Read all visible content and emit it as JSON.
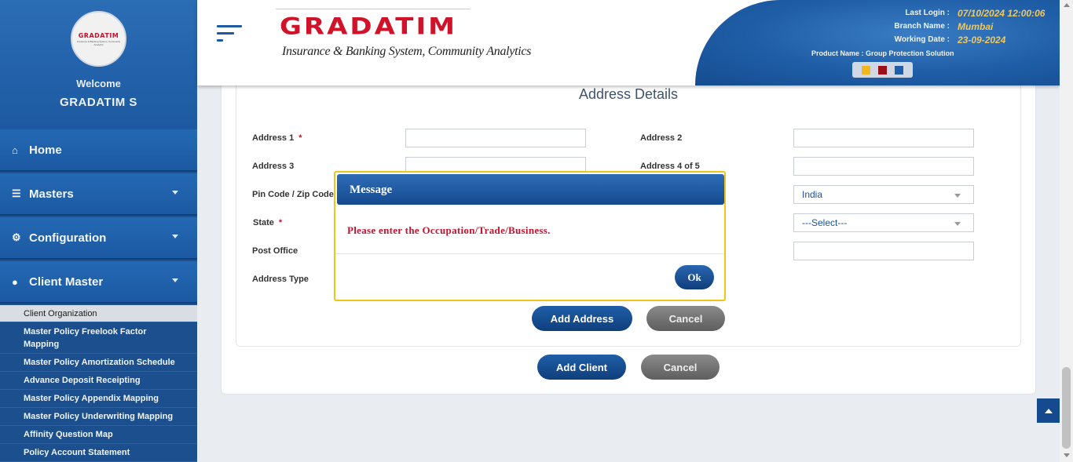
{
  "sidebar": {
    "logo_text": "GRADATIM",
    "logo_subtext": "Insurance & Banking System, Community Analytics",
    "welcome": "Welcome",
    "user_name": "GRADATIM S",
    "menu": [
      {
        "label": "Home",
        "icon": "home-icon"
      },
      {
        "label": "Masters",
        "icon": "database-icon"
      },
      {
        "label": "Configuration",
        "icon": "gears-icon"
      },
      {
        "label": "Client Master",
        "icon": "user-icon"
      }
    ],
    "submenu": [
      "Client Organization",
      "Master Policy Freelook Factor Mapping",
      "Master Policy Amortization Schedule",
      "Advance Deposit Receipting",
      "Master Policy Appendix Mapping",
      "Master Policy Underwriting Mapping",
      "Affinity Question Map",
      "Policy Account Statement"
    ]
  },
  "header": {
    "logo_title": "GRADATIM",
    "logo_subtitle": "Insurance & Banking System, Community Analytics",
    "last_login_label": "Last Login :",
    "last_login_value": "07/10/2024 12:00:06",
    "branch_label": "Branch Name :",
    "branch_value": "Mumbai",
    "working_date_label": "Working Date :",
    "working_date_value": "23-09-2024",
    "product_name": "Product Name : Group Protection Solution",
    "theme_colors": [
      "#f2b71d",
      "#9b0f18",
      "#1f5ea8"
    ]
  },
  "form": {
    "section_title": "Address Details",
    "labels": {
      "address1": "Address 1",
      "address2": "Address 2",
      "address3": "Address 3",
      "address4": "Address 4 of 5",
      "pincode": "Pin Code / Zip Code",
      "state": "State",
      "post_office": "Post Office",
      "address_type": "Address Type"
    },
    "required_mark": "*",
    "country_value": "India",
    "state_select_value": "---Select---",
    "add_address": "Add Address",
    "cancel": "Cancel",
    "add_client": "Add Client",
    "cancel2": "Cancel"
  },
  "modal": {
    "title": "Message",
    "message": "Please enter the Occupation/Trade/Business.",
    "ok": "Ok"
  }
}
